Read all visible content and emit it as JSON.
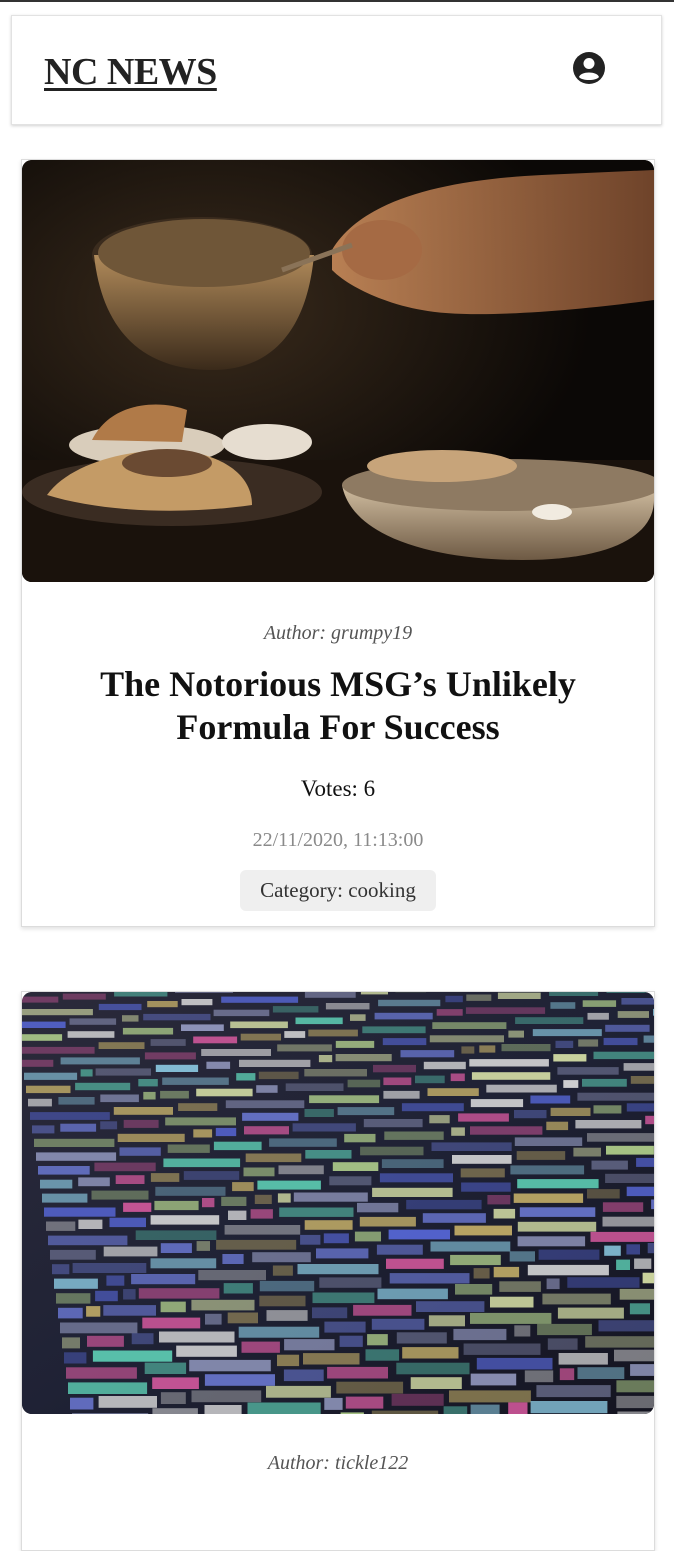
{
  "header": {
    "logo": "NC NEWS",
    "account_icon": "account-circle-icon"
  },
  "articles": [
    {
      "image": "cooking-photo",
      "author": "Author: grumpy19",
      "title": "The Notorious MSG’s Unlikely Formula For Success",
      "votes": "Votes: 6",
      "date": "22/11/2020, 11:13:00",
      "category": "Category: cooking"
    },
    {
      "image": "code-on-screen-photo",
      "author": "Author: tickle122"
    }
  ]
}
